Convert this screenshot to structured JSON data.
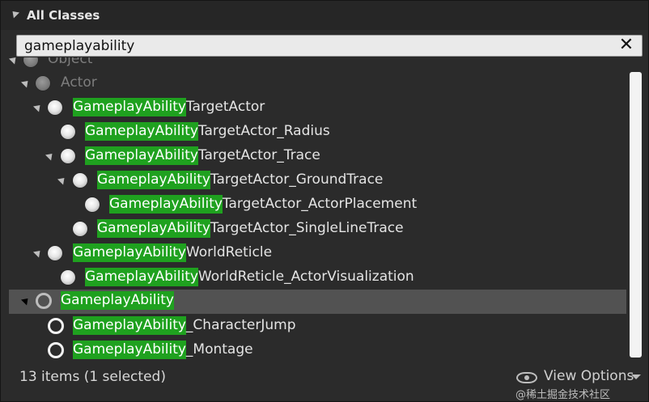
{
  "header": {
    "title": "All Classes"
  },
  "search": {
    "value": "gameplayability"
  },
  "tree": {
    "items": [
      {
        "prefix": "",
        "rest": "Object"
      },
      {
        "prefix": "",
        "rest": "Actor"
      },
      {
        "prefix": "GameplayAbility",
        "rest": "TargetActor"
      },
      {
        "prefix": "GameplayAbility",
        "rest": "TargetActor_Radius"
      },
      {
        "prefix": "GameplayAbility",
        "rest": "TargetActor_Trace"
      },
      {
        "prefix": "GameplayAbility",
        "rest": "TargetActor_GroundTrace"
      },
      {
        "prefix": "GameplayAbility",
        "rest": "TargetActor_ActorPlacement"
      },
      {
        "prefix": "GameplayAbility",
        "rest": "TargetActor_SingleLineTrace"
      },
      {
        "prefix": "GameplayAbility",
        "rest": "WorldReticle"
      },
      {
        "prefix": "GameplayAbility",
        "rest": "WorldReticle_ActorVisualization"
      },
      {
        "prefix": "GameplayAbility",
        "rest": ""
      },
      {
        "prefix": "GameplayAbility",
        "rest": "_CharacterJump"
      },
      {
        "prefix": "GameplayAbility",
        "rest": "_Montage"
      }
    ]
  },
  "footer": {
    "count": "13 items (1 selected)",
    "view_options": "View Options",
    "watermark": "@稀土掘金技术社区"
  },
  "colors": {
    "highlight": "#1fa11f",
    "selected_row": "#525252"
  }
}
